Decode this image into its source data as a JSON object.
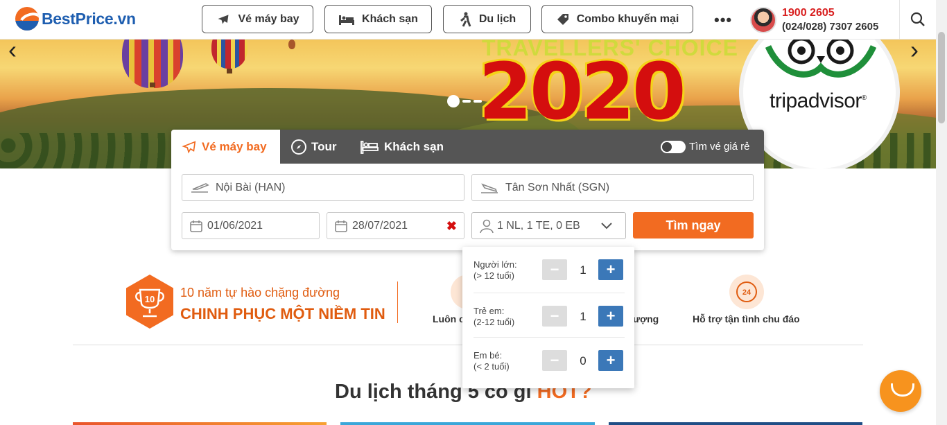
{
  "header": {
    "logo": "BestPrice.vn",
    "nav": [
      {
        "label": "Vé máy bay",
        "icon": "plane-icon"
      },
      {
        "label": "Khách sạn",
        "icon": "bed-icon"
      },
      {
        "label": "Du lịch",
        "icon": "hiker-icon"
      },
      {
        "label": "Combo khuyến mại",
        "icon": "tag-icon"
      }
    ],
    "more": "•••",
    "hotline": "1900 2605",
    "hotline_alt": "(024/028) 7307 2605"
  },
  "banner": {
    "award_text": "TRAVELLERS' CHOICE",
    "year": "2020",
    "brand": "tripadvisor",
    "brand_mark": "®",
    "prev": "‹",
    "next": "›"
  },
  "search": {
    "tabs": [
      {
        "label": "Vé máy bay",
        "icon": "plane-icon",
        "active": true
      },
      {
        "label": "Tour",
        "icon": "compass-icon",
        "active": false
      },
      {
        "label": "Khách sạn",
        "icon": "bed-icon",
        "active": false
      }
    ],
    "cheap_toggle_label": "Tìm vé giá rẻ",
    "from": "Nội Bài (HAN)",
    "to": "Tân Sơn Nhất (SGN)",
    "depart_date": "01/06/2021",
    "return_date": "28/07/2021",
    "clear": "✖",
    "passengers": "1 NL, 1 TE, 0 EB",
    "submit": "Tìm ngay"
  },
  "pax": [
    {
      "label": "Người lớn:",
      "sub": "(> 12 tuổi)",
      "count": "1",
      "minus": "−",
      "plus": "+"
    },
    {
      "label": "Trẻ em:",
      "sub": "(2-12 tuổi)",
      "count": "1",
      "minus": "−",
      "plus": "+"
    },
    {
      "label": "Em bé:",
      "sub": "(< 2 tuổi)",
      "count": "0",
      "minus": "−",
      "plus": "+"
    }
  ],
  "features": {
    "badge": "10",
    "proud_line1": "10 năm tự hào chặng đường",
    "proud_line2": "CHINH PHỤC MỘT NIỀM TIN",
    "item1": "Luôn c",
    "item2": "ượng",
    "item3": "Hỗ trợ tận tình chu đáo",
    "support_badge": "24"
  },
  "section": {
    "title": "Du lịch tháng 5 có gì ",
    "hot": "HOT?"
  },
  "colors": {
    "brand_orange": "#f26b21",
    "brand_blue": "#1e5eb0",
    "plus_blue": "#3b78b8",
    "hotline_red": "#d81e1e"
  }
}
